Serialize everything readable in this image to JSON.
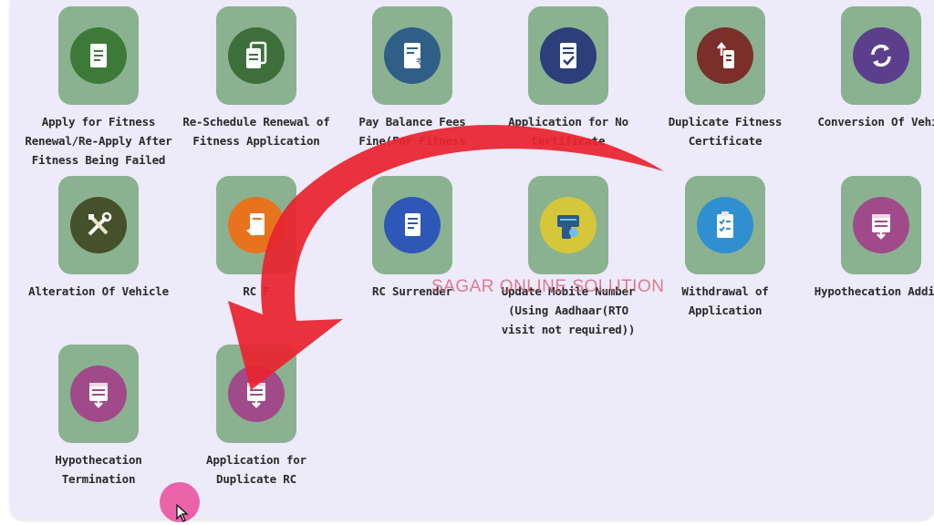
{
  "services": [
    {
      "label": "Apply for Fitness Renewal/Re-Apply After Fitness Being Failed",
      "icon": "document-icon",
      "color": "#3d7a3a"
    },
    {
      "label": "Re-Schedule Renewal of Fitness Application",
      "icon": "copy-documents-icon",
      "color": "#3e6f3a"
    },
    {
      "label": "Pay Balance Fees Fine(For Fitness",
      "icon": "rupee-receipt-icon",
      "color": "#2f5e86"
    },
    {
      "label": "Application for No Certificate",
      "icon": "checklist-document-icon",
      "color": "#2c3f7a"
    },
    {
      "label": "Duplicate Fitness Certificate",
      "icon": "upload-document-icon",
      "color": "#7a2f2a"
    },
    {
      "label": "Conversion Of Vehic",
      "icon": "refresh-icon",
      "color": "#5b3f8c"
    },
    {
      "label": "Alteration Of Vehicle",
      "icon": "tools-icon",
      "color": "#46502a"
    },
    {
      "label": "RC F",
      "icon": "rc-document-icon",
      "color": "#e8731f"
    },
    {
      "label": "RC Surrender",
      "icon": "surrender-document-icon",
      "color": "#2e57b8"
    },
    {
      "label": "Update Mobile Number (Using Aadhaar(RTO visit not required))",
      "icon": "mobile-card-icon",
      "color": "#d6c63a"
    },
    {
      "label": "Withdrawal of Application",
      "icon": "clipboard-icon",
      "color": "#2f8fd0"
    },
    {
      "label": "Hypothecation Additi",
      "icon": "hypothecation-icon",
      "color": "#a04a8a"
    },
    {
      "label": "Hypothecation Termination",
      "icon": "hypothecation-icon",
      "color": "#a04a8a"
    },
    {
      "label": "Application for Duplicate RC",
      "icon": "hypothecation-icon",
      "color": "#a04a8a"
    }
  ],
  "watermark": "SAGAR ONLINE SOLUTION",
  "overlay": {
    "arrow_color": "#e8232e",
    "cursor_highlight_color": "#e94b9c"
  }
}
